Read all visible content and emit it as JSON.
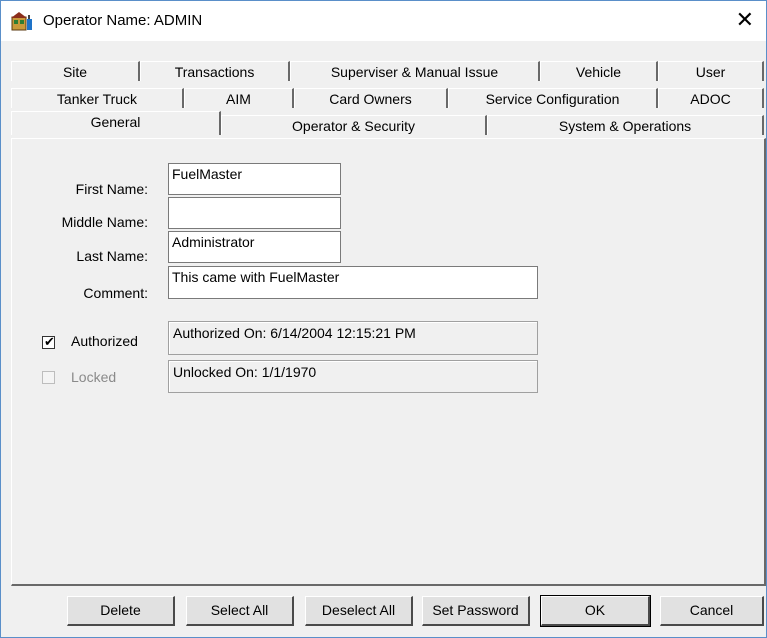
{
  "window": {
    "title": "Operator Name: ADMIN",
    "close_glyph": "✕"
  },
  "tabs": {
    "row1": [
      "Site",
      "Transactions",
      "Superviser & Manual Issue",
      "Vehicle",
      "User"
    ],
    "row2": [
      "Tanker Truck",
      "AIM",
      "Card Owners",
      "Service Configuration",
      "ADOC"
    ],
    "row3": [
      "General",
      "Operator & Security",
      "System & Operations"
    ],
    "active": "General"
  },
  "form": {
    "first_name_label": "First Name:",
    "first_name_value": "FuelMaster",
    "middle_name_label": "Middle Name:",
    "middle_name_value": "",
    "last_name_label": "Last Name:",
    "last_name_value": "Administrator",
    "comment_label": "Comment:",
    "comment_value": "This came with FuelMaster",
    "authorized_label": "Authorized",
    "authorized_checked": true,
    "authorized_info": "Authorized On: 6/14/2004 12:15:21 PM",
    "locked_label": "Locked",
    "locked_checked": false,
    "locked_info": "Unlocked On: 1/1/1970"
  },
  "buttons": {
    "delete": "Delete",
    "select_all": "Select All",
    "deselect_all": "Deselect All",
    "set_password": "Set Password",
    "ok": "OK",
    "cancel": "Cancel"
  },
  "icons": {
    "app": "fuel-pump-building-icon",
    "close": "close-icon",
    "check": "checkmark-icon"
  }
}
